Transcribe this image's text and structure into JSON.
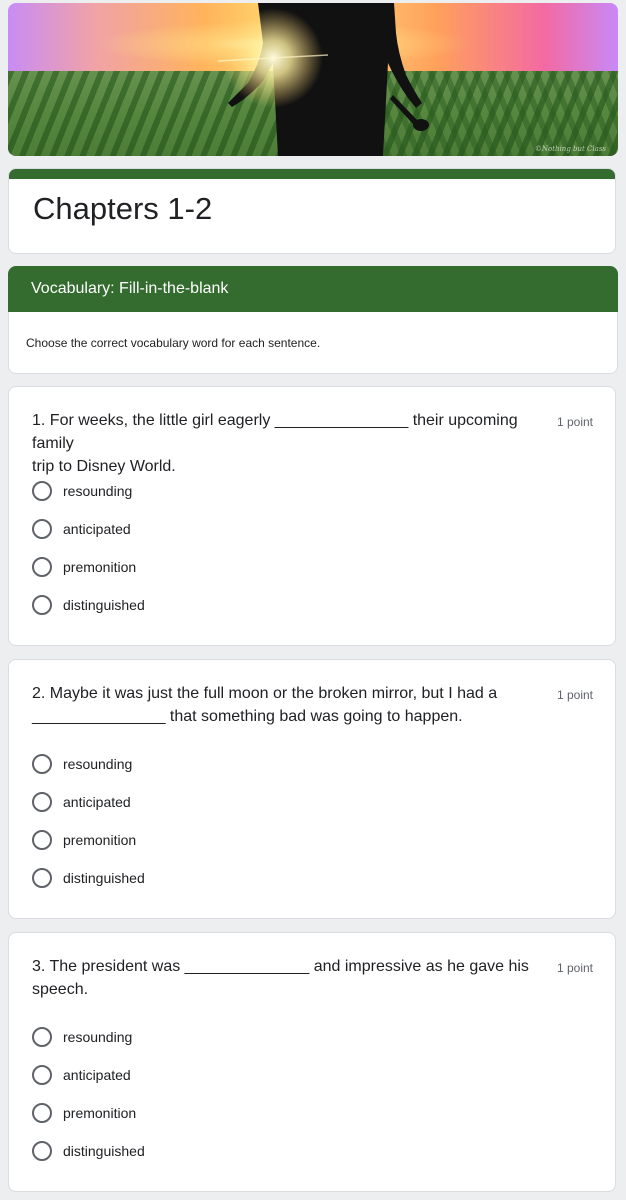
{
  "banner": {
    "credit": "©Nothing but Class"
  },
  "form": {
    "title": "Chapters 1-2"
  },
  "section": {
    "title": "Vocabulary: Fill-in-the-blank",
    "description": "Choose the correct vocabulary word for each sentence."
  },
  "questions": [
    {
      "line1": "1. For weeks, the little girl eagerly _______________ their upcoming family",
      "line2": "trip to Disney World.",
      "points": "1 point",
      "options": [
        "resounding",
        "anticipated",
        "premonition",
        "distinguished"
      ]
    },
    {
      "line1": "2. Maybe it was just the full moon or the broken mirror, but I had a",
      "line2": "_______________ that something bad was going to happen.",
      "points": "1 point",
      "options": [
        "resounding",
        "anticipated",
        "premonition",
        "distinguished"
      ]
    },
    {
      "line1": "3. The president was ______________ and impressive as he gave his",
      "line2": "speech.",
      "points": "1 point",
      "options": [
        "resounding",
        "anticipated",
        "premonition",
        "distinguished"
      ]
    }
  ]
}
